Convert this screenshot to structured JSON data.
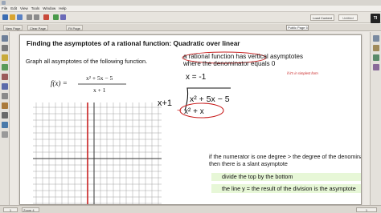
{
  "menu": [
    "File",
    "Edit",
    "View",
    "Tools",
    "Window",
    "Help"
  ],
  "toolbar": {
    "load_content_label": "Load Content",
    "save_label": "Untitled"
  },
  "subtoolbar": {
    "new_page": "New Page",
    "clear_page": "Clear Page",
    "fit_page": "Fit Page",
    "page_select": "Public Page 5"
  },
  "logo_text": "TI",
  "page": {
    "title": "Finding the asymptotes of a rational function: Quadratic over linear",
    "instruction": "Graph all asymptotes of the following function.",
    "function": {
      "lhs": "f(x) =",
      "numerator": "x² + 5x − 5",
      "denominator": "x + 1"
    },
    "notes": {
      "rational_line1": "a rational function has vertical asymptotes",
      "rational_line2": "where the denominator equals 0",
      "simplest": "if it's in simplest form",
      "slant_line1": "if the numerator is one degree > the degree of the denominator",
      "slant_line2": "then there is a slant asymptote",
      "divide": "divide the top by the bottom",
      "line_result": "the line y = the result of the division is the asymptote"
    },
    "handwriting": {
      "x_eq": "x = -1",
      "divisor": "x+1",
      "dividend": "x² + 5x − 5",
      "subtract": "x² + x"
    }
  },
  "status": {
    "left": "1",
    "zoom": "Zoom 4",
    "right": "1"
  },
  "colors": {
    "ink_red": "#c82020",
    "ink_black": "#111111",
    "highlight_green": "#e7f7d7",
    "grid": "#9a9a9a"
  }
}
